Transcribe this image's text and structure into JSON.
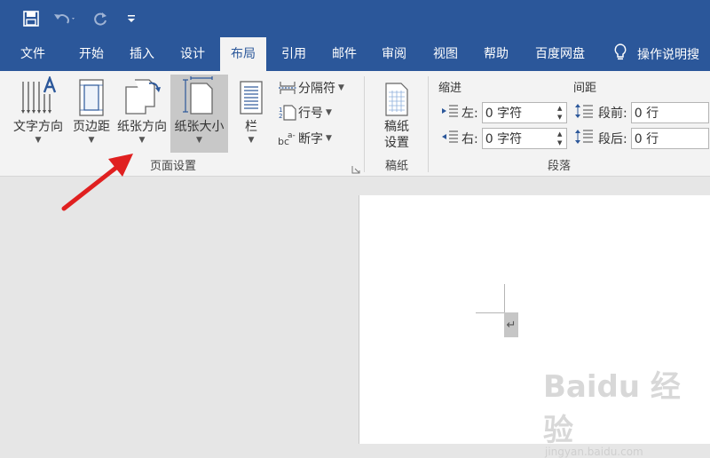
{
  "quick_access": {
    "save": "save-icon",
    "undo": "undo-icon",
    "redo": "redo-icon",
    "customize": "customize-icon"
  },
  "tabs": [
    {
      "label": "文件"
    },
    {
      "label": "开始"
    },
    {
      "label": "插入"
    },
    {
      "label": "设计"
    },
    {
      "label": "布局",
      "active": true
    },
    {
      "label": "引用"
    },
    {
      "label": "邮件"
    },
    {
      "label": "审阅"
    },
    {
      "label": "视图"
    },
    {
      "label": "帮助"
    },
    {
      "label": "百度网盘"
    }
  ],
  "tell_me": "操作说明搜",
  "ribbon": {
    "text_direction": "文字方向",
    "margins": "页边距",
    "orientation": "纸张方向",
    "size": "纸张大小",
    "columns": "栏",
    "breaks": "分隔符",
    "line_numbers": "行号",
    "hyphenation": "断字",
    "page_setup_group": "页面设置",
    "draft_settings_l1": "稿纸",
    "draft_settings_l2": "设置",
    "draft_group": "稿纸",
    "indent_header": "缩进",
    "spacing_header": "间距",
    "indent_left_label": "左:",
    "indent_left_value": "0 字符",
    "indent_right_label": "右:",
    "indent_right_value": "0 字符",
    "space_before_label": "段前:",
    "space_before_value": "0 行",
    "space_after_label": "段后:",
    "space_after_value": "0 行",
    "paragraph_group": "段落"
  },
  "document": {
    "paragraph_mark": "↵"
  },
  "watermark": {
    "brand": "Baidu 经验",
    "url": "jingyan.baidu.com"
  },
  "colors": {
    "accent": "#2b579a",
    "arrow": "#e02020"
  }
}
